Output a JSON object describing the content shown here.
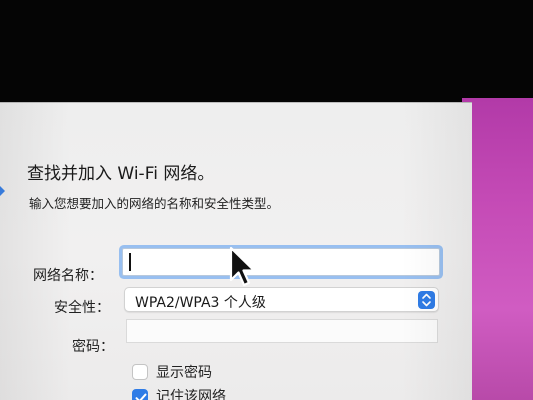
{
  "dialog": {
    "title": "查找并加入 Wi-Fi 网络。",
    "subtitle": "输入您想要加入的网络的名称和安全性类型。",
    "fields": {
      "network_name": {
        "label": "网络名称：",
        "value": ""
      },
      "security": {
        "label": "安全性：",
        "selected": "WPA2/WPA3 个人级"
      },
      "password": {
        "label": "密码：",
        "value": ""
      }
    },
    "checkboxes": {
      "show_password": {
        "label": "显示密码",
        "checked": false
      },
      "remember_network": {
        "label": "记住该网络",
        "checked": true
      }
    }
  },
  "colors": {
    "accent": "#2f7ce6",
    "focus_ring": "#98bff0",
    "dialog_bg": "#efeeee",
    "wallpaper": "#c54bb6"
  },
  "icons": [
    "chevron-updown-icon",
    "checkmark-icon",
    "mouse-pointer-icon",
    "edge-arrow-icon"
  ]
}
